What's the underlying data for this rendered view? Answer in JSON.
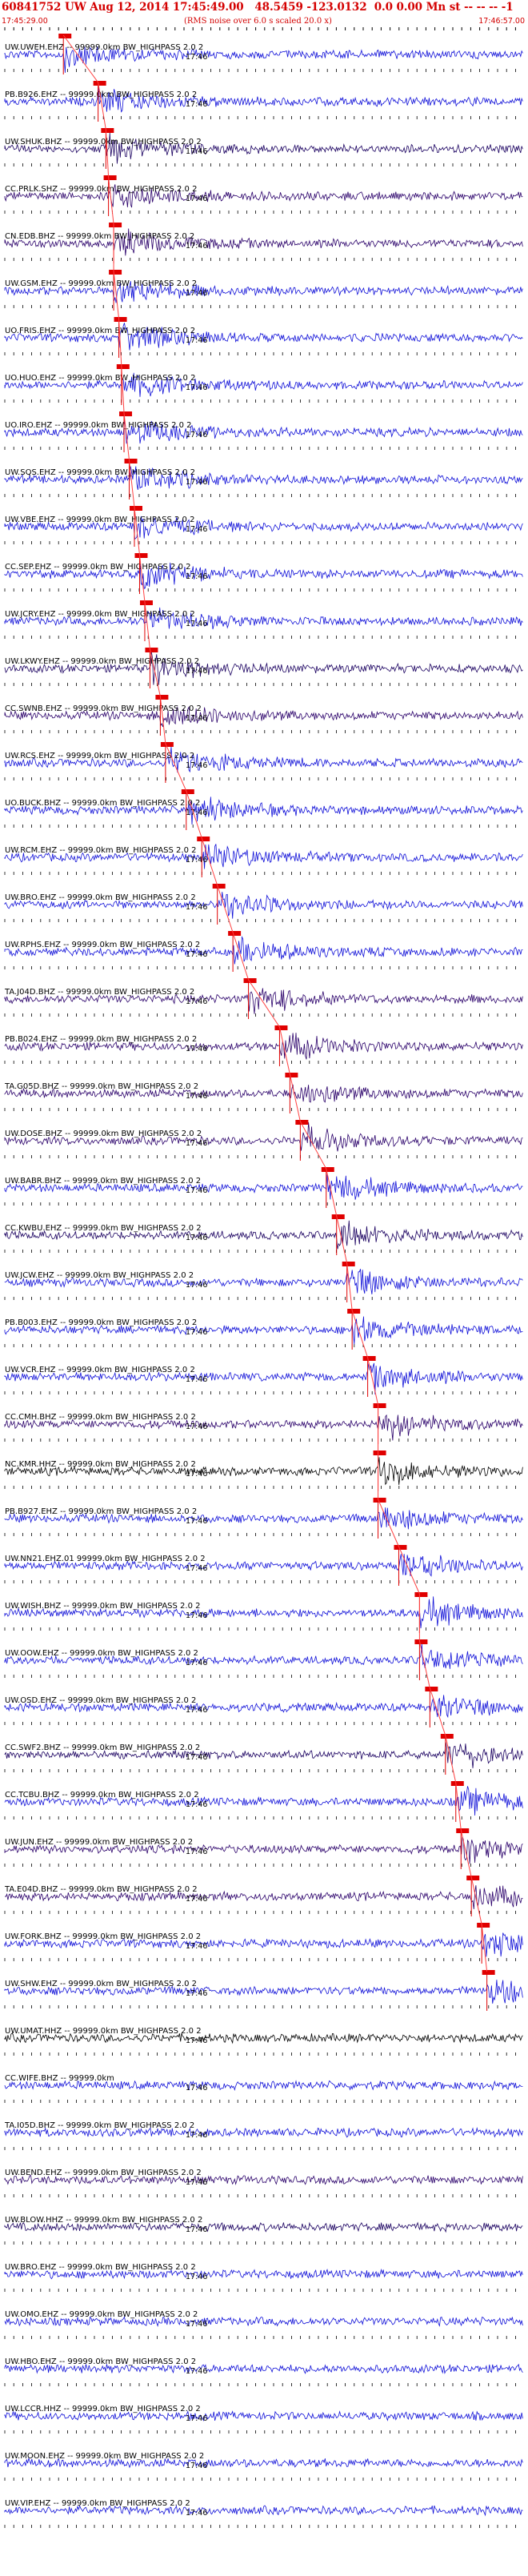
{
  "header": {
    "title": "60841752 UW Aug 12, 2014 17:45:49.00   48.5459 -123.0132  0.0 0.00 Mn st -- -- -- -1",
    "subtitle": "(RMS noise over 6.0 s scaled 20.0 x)",
    "start_time": "17:45:29.00",
    "end_time": "17:46:57.00"
  },
  "traces": [
    {
      "label": "UW.UWEH.EHZ -- 99999.0km BW_HIGHPASS  2.0  2",
      "time": "17:46",
      "color": "#1010d8",
      "marker": 0.113,
      "pick": "S"
    },
    {
      "label": "PB.B926.EHZ -- 99999.0km BW_HIGHPASS  2.0  2",
      "time": "17:46",
      "color": "#1010d8",
      "marker": 0.18,
      "pick": ""
    },
    {
      "label": "UW.SHUK.BHZ -- 99999.0km BW_HIGHPASS  2.0  2",
      "time": "17:46",
      "color": "#1a0060",
      "marker": 0.195,
      "pick": ""
    },
    {
      "label": "CC.PRLK.SHZ -- 99999.0km BW_HIGHPASS  2.0  2",
      "time": "17:46",
      "color": "#2a006a",
      "marker": 0.2,
      "pick": ""
    },
    {
      "label": "CN.EDB.BHZ -- 99999.0km BW_HIGHPASS  2.0  2",
      "time": "17:46",
      "color": "#2a006a",
      "marker": 0.21,
      "pick": ""
    },
    {
      "label": "UW.GSM.EHZ -- 99999.0km BW_HIGHPASS  2.0  2",
      "time": "17:46",
      "color": "#1010d8",
      "marker": 0.21,
      "pick": ""
    },
    {
      "label": "UO.FRIS.EHZ -- 99999.0km BW_HIGHPASS  2.0  2",
      "time": "17:46",
      "color": "#1010d8",
      "marker": 0.22,
      "pick": ""
    },
    {
      "label": "UO.HUO.EHZ -- 99999.0km BW_HIGHPASS  2.0  2",
      "time": "17:46",
      "color": "#1010d8",
      "marker": 0.225,
      "pick": ""
    },
    {
      "label": "UO.IRO.EHZ -- 99999.0km BW_HIGHPASS  2.0  2",
      "time": "17:46",
      "color": "#1010d8",
      "marker": 0.23,
      "pick": ""
    },
    {
      "label": "UW.SQS.EHZ -- 99999.0km BW_HIGHPASS  2.0  2",
      "time": "17:46",
      "color": "#1010d8",
      "marker": 0.24,
      "pick": ""
    },
    {
      "label": "UW.VBE.EHZ -- 99999.0km BW_HIGHPASS  2.0  2",
      "time": "17:46",
      "color": "#1010d8",
      "marker": 0.25,
      "pick": ""
    },
    {
      "label": "CC.SEP.EHZ -- 99999.0km BW_HIGHPASS  2.0  2",
      "time": "17:46",
      "color": "#1010d8",
      "marker": 0.26,
      "pick": ""
    },
    {
      "label": "UW.JCRY.EHZ -- 99999.0km BW_HIGHPASS  2.0  2",
      "time": "17:46",
      "color": "#1010d8",
      "marker": 0.27,
      "pick": ""
    },
    {
      "label": "UW.LKWY.EHZ -- 99999.0km BW_HIGHPASS  2.0  2",
      "time": "17:46",
      "color": "#1a0060",
      "marker": 0.28,
      "pick": ""
    },
    {
      "label": "CC.SWNB.EHZ -- 99999.0km BW_HIGHPASS  2.0  2",
      "time": "17:46",
      "color": "#2a006a",
      "marker": 0.3,
      "pick": ""
    },
    {
      "label": "UW.RCS.EHZ -- 99999.0km BW_HIGHPASS  2.0  2",
      "time": "17:46",
      "color": "#1010d8",
      "marker": 0.31,
      "pick": ""
    },
    {
      "label": "UO.BUCK.BHZ -- 99999.0km BW_HIGHPASS  2.0  2",
      "time": "17:46",
      "color": "#1010d8",
      "marker": 0.35,
      "pick": ""
    },
    {
      "label": "UW.RCM.EHZ -- 99999.0km BW_HIGHPASS  2.0  2",
      "time": "17:46",
      "color": "#1010d8",
      "marker": 0.38,
      "pick": ""
    },
    {
      "label": "UW.BRO.EHZ -- 99999.0km BW_HIGHPASS  2.0  2",
      "time": "17:46",
      "color": "#1010d8",
      "marker": 0.41,
      "pick": ""
    },
    {
      "label": "UW.RPHS.EHZ -- 99999.0km BW_HIGHPASS  2.0  2",
      "time": "17:46",
      "color": "#1010d8",
      "marker": 0.44,
      "pick": ""
    },
    {
      "label": "TA.J04D.BHZ -- 99999.0km BW_HIGHPASS  2.0  2",
      "time": "17:46",
      "color": "#2a006a",
      "marker": 0.47,
      "pick": ""
    },
    {
      "label": "PB.B024.EHZ -- 99999.0km BW_HIGHPASS  2.0  2",
      "time": "17:46",
      "color": "#2a006a",
      "marker": 0.53,
      "pick": ""
    },
    {
      "label": "TA.G05D.BHZ -- 99999.0km BW_HIGHPASS  2.0  2",
      "time": "17:46",
      "color": "#2a006a",
      "marker": 0.55,
      "pick": ""
    },
    {
      "label": "UW.DOSE.BHZ -- 99999.0km BW_HIGHPASS  2.0  2",
      "time": "17:46",
      "color": "#2a006a",
      "marker": 0.57,
      "pick": ""
    },
    {
      "label": "UW.BABR.BHZ -- 99999.0km BW_HIGHPASS  2.0  2",
      "time": "17:46",
      "color": "#1010d8",
      "marker": 0.62,
      "pick": ""
    },
    {
      "label": "CC.KWBU.EHZ -- 99999.0km BW_HIGHPASS  2.0  2",
      "time": "17:46",
      "color": "#1a0060",
      "marker": 0.64,
      "pick": ""
    },
    {
      "label": "UW.JCW.EHZ -- 99999.0km BW_HIGHPASS  2.0  2",
      "time": "17:46",
      "color": "#1010d8",
      "marker": 0.66,
      "pick": ""
    },
    {
      "label": "PB.B003.EHZ -- 99999.0km BW_HIGHPASS  2.0  2",
      "time": "17:46",
      "color": "#1010d8",
      "marker": 0.67,
      "pick": ""
    },
    {
      "label": "UW.VCR.EHZ -- 99999.0km BW_HIGHPASS  2.0  2",
      "time": "17:46",
      "color": "#1010d8",
      "marker": 0.7,
      "pick": ""
    },
    {
      "label": "CC.CMH.BHZ -- 99999.0km BW_HIGHPASS  2.0  2",
      "time": "17:46",
      "color": "#2a006a",
      "marker": 0.72,
      "pick": ""
    },
    {
      "label": "NC.KMR.HHZ -- 99999.0km BW_HIGHPASS  2.0  2",
      "time": "17:46",
      "color": "#000000",
      "marker": 0.72,
      "pick": ""
    },
    {
      "label": "PB.B927.EHZ -- 99999.0km BW_HIGHPASS  2.0  2",
      "time": "17:46",
      "color": "#1010d8",
      "marker": 0.72,
      "pick": ""
    },
    {
      "label": "UW.NN21.EHZ.01 99999.0km BW_HIGHPASS  2.0  2",
      "time": "17:46",
      "color": "#1010d8",
      "marker": 0.76,
      "pick": ""
    },
    {
      "label": "UW.WISH.BHZ -- 99999.0km BW_HIGHPASS  2.0  2",
      "time": "17:46",
      "color": "#1010d8",
      "marker": 0.8,
      "pick": ""
    },
    {
      "label": "UW.OOW.EHZ -- 99999.0km BW_HIGHPASS  2.0  2",
      "time": "17:46",
      "color": "#1010d8",
      "marker": 0.8,
      "pick": ""
    },
    {
      "label": "UW.OSD.EHZ -- 99999.0km BW_HIGHPASS  2.0  2",
      "time": "17:46",
      "color": "#1010d8",
      "marker": 0.82,
      "pick": ""
    },
    {
      "label": "CC.SWF2.BHZ -- 99999.0km BW_HIGHPASS  2.0  2",
      "time": "17:46",
      "color": "#1a0060",
      "marker": 0.85,
      "pick": ""
    },
    {
      "label": "CC.TCBU.BHZ -- 99999.0km BW_HIGHPASS  2.0  2",
      "time": "17:46",
      "color": "#1010d8",
      "marker": 0.87,
      "pick": ""
    },
    {
      "label": "UW.JUN.EHZ -- 99999.0km BW_HIGHPASS  2.0  2",
      "time": "17:46",
      "color": "#2a006a",
      "marker": 0.88,
      "pick": ""
    },
    {
      "label": "TA.E04D.BHZ -- 99999.0km BW_HIGHPASS  2.0  2",
      "time": "17:46",
      "color": "#2a006a",
      "marker": 0.9,
      "pick": ""
    },
    {
      "label": "UW.FORK.BHZ -- 99999.0km BW_HIGHPASS  2.0  2",
      "time": "17:46",
      "color": "#1010d8",
      "marker": 0.92,
      "pick": ""
    },
    {
      "label": "UW.SHW.EHZ -- 99999.0km BW_HIGHPASS  2.0  2",
      "time": "17:46",
      "color": "#1010d8",
      "marker": 0.93,
      "pick": ""
    },
    {
      "label": "UW.UMAT.HHZ -- 99999.0km BW_HIGHPASS  2.0  2",
      "time": "17:46",
      "color": "#000000",
      "marker": -1,
      "pick": ""
    },
    {
      "label": "CC.WIFE.BHZ -- 99999.0km",
      "time": "17:46",
      "color": "#1010d8",
      "marker": -1,
      "pick": ""
    },
    {
      "label": "TA.I05D.BHZ -- 99999.0km BW_HIGHPASS  2.0  2",
      "time": "17:46",
      "color": "#1010d8",
      "marker": -1,
      "pick": ""
    },
    {
      "label": "UW.BEND.EHZ -- 99999.0km BW_HIGHPASS  2.0  2",
      "time": "17:46",
      "color": "#2a006a",
      "marker": -1,
      "pick": ""
    },
    {
      "label": "UW.BLOW.HHZ -- 99999.0km BW_HIGHPASS  2.0  2",
      "time": "17:46",
      "color": "#1a0060",
      "marker": -1,
      "pick": ""
    },
    {
      "label": "UW.BRO.EHZ -- 99999.0km BW_HIGHPASS  2.0  2",
      "time": "17:46",
      "color": "#1010d8",
      "marker": -1,
      "pick": ""
    },
    {
      "label": "UW.OMO.EHZ -- 99999.0km BW_HIGHPASS  2.0  2",
      "time": "17:46",
      "color": "#1010d8",
      "marker": -1,
      "pick": ""
    },
    {
      "label": "UW.HBO.EHZ -- 99999.0km BW_HIGHPASS  2.0  2",
      "time": "17:46",
      "color": "#1010d8",
      "marker": -1,
      "pick": ""
    },
    {
      "label": "UW.LCCR.HHZ -- 99999.0km BW_HIGHPASS  2.0  2",
      "time": "17:46",
      "color": "#1010d8",
      "marker": -1,
      "pick": ""
    },
    {
      "label": "UW.MOON.EHZ -- 99999.0km BW_HIGHPASS  2.0  2",
      "time": "17:46",
      "color": "#1010d8",
      "marker": -1,
      "pick": ""
    },
    {
      "label": "UW.VIP.EHZ -- 99999.0km BW_HIGHPASS  2.0  2",
      "time": "17:46",
      "color": "#1010d8",
      "marker": -1,
      "pick": ""
    }
  ],
  "colors": {
    "title": "#d40000",
    "pick_marker": "#e00000",
    "moveout_line": "#ff4040",
    "tick_line": "#000000"
  }
}
